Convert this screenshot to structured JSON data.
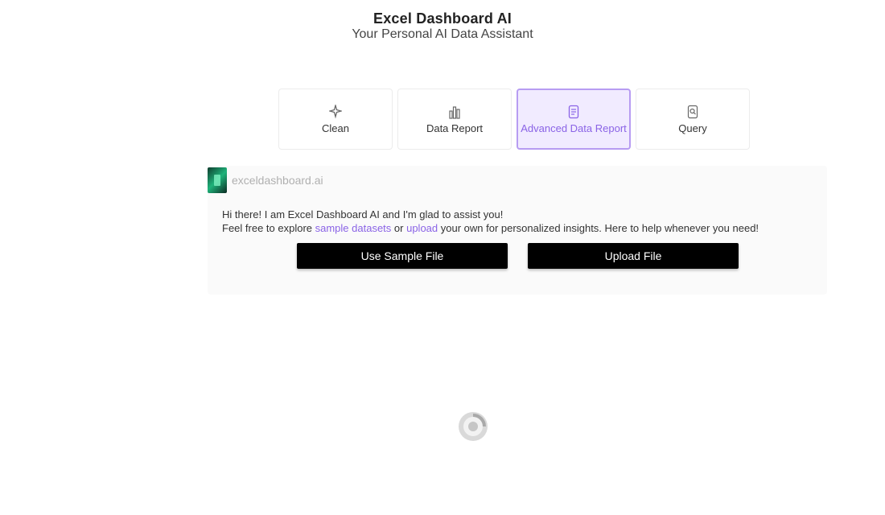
{
  "header": {
    "title": "Excel Dashboard AI",
    "subtitle": "Your Personal AI Data Assistant"
  },
  "modes": [
    {
      "label": "Clean",
      "meta": "",
      "icon": "sparkle-icon",
      "active": false
    },
    {
      "label": "Data Report",
      "meta": "",
      "icon": "bar-chart-icon",
      "active": false
    },
    {
      "label": "Advanced Data Report",
      "meta": "",
      "icon": "document-icon",
      "active": true
    },
    {
      "label": "Query",
      "meta": "",
      "icon": "search-icon",
      "active": false
    }
  ],
  "chat": {
    "bot_name": "exceldashboard.ai",
    "greeting_line1": "Hi there! I am Excel Dashboard AI and I'm glad to assist you!",
    "greeting_line2_prefix": "Feel free to explore ",
    "greeting_link1": "sample datasets",
    "greeting_line2_mid": " or ",
    "greeting_link2": "upload",
    "greeting_line2_suffix": " your own for personalized insights. Here to help whenever you need!",
    "use_sample_label": "Use Sample File",
    "upload_label": "Upload File"
  },
  "colors": {
    "accent": "#8a63e6",
    "active_bg": "#f1ebff",
    "button_bg": "#000000"
  }
}
